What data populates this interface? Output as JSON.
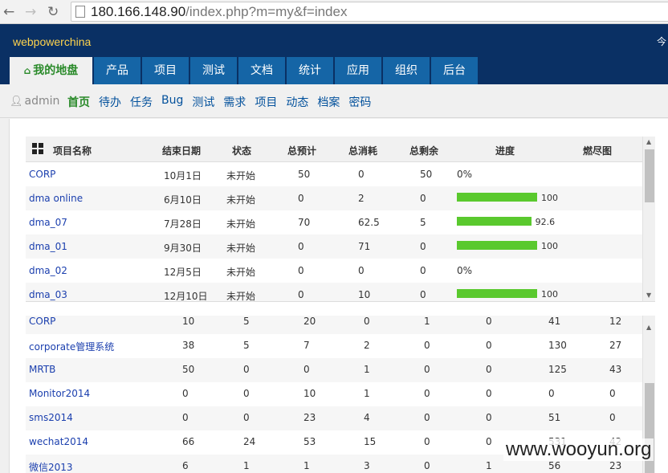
{
  "browser": {
    "url_main": "180.166.148.90",
    "url_path": "/index.php?m=my&f=index"
  },
  "header": {
    "brand": "webpowerchina",
    "right_text": "今"
  },
  "mainnav": [
    {
      "label": "我的地盘",
      "active": true
    },
    {
      "label": "产品"
    },
    {
      "label": "项目"
    },
    {
      "label": "测试"
    },
    {
      "label": "文档"
    },
    {
      "label": "统计"
    },
    {
      "label": "应用"
    },
    {
      "label": "组织"
    },
    {
      "label": "后台"
    }
  ],
  "subnav": {
    "user": "admin",
    "links": [
      {
        "label": "首页",
        "active": true
      },
      {
        "label": "待办"
      },
      {
        "label": "任务"
      },
      {
        "label": "Bug"
      },
      {
        "label": "测试"
      },
      {
        "label": "需求"
      },
      {
        "label": "项目"
      },
      {
        "label": "动态"
      },
      {
        "label": "档案"
      },
      {
        "label": "密码"
      }
    ]
  },
  "project_table": {
    "headers": [
      "项目名称",
      "结束日期",
      "状态",
      "总预计",
      "总消耗",
      "总剩余",
      "进度",
      "燃尽图"
    ],
    "rows": [
      {
        "name": "CORP",
        "end": "10月1日",
        "status": "未开始",
        "est": "50",
        "cons": "0",
        "left": "50",
        "progress": 0,
        "progress_label": "0%"
      },
      {
        "name": "dma online",
        "end": "6月10日",
        "status": "未开始",
        "est": "0",
        "cons": "2",
        "left": "0",
        "progress": 100,
        "progress_label": "100"
      },
      {
        "name": "dma_07",
        "end": "7月28日",
        "status": "未开始",
        "est": "70",
        "cons": "62.5",
        "left": "5",
        "progress": 92.6,
        "progress_label": "92.6"
      },
      {
        "name": "dma_01",
        "end": "9月30日",
        "status": "未开始",
        "est": "0",
        "cons": "71",
        "left": "0",
        "progress": 100,
        "progress_label": "100"
      },
      {
        "name": "dma_02",
        "end": "12月5日",
        "status": "未开始",
        "est": "0",
        "cons": "0",
        "left": "0",
        "progress": 0,
        "progress_label": "0%"
      },
      {
        "name": "dma_03",
        "end": "12月10日",
        "status": "未开始",
        "est": "0",
        "cons": "10",
        "left": "0",
        "progress": 100,
        "progress_label": "100"
      }
    ]
  },
  "product_table": {
    "rows": [
      {
        "name": "CORP",
        "c1": "10",
        "c2": "5",
        "c3": "20",
        "c4": "0",
        "c5": "1",
        "c6": "0",
        "c7": "41",
        "c8": "12"
      },
      {
        "name": "corporate管理系统",
        "c1": "38",
        "c2": "5",
        "c3": "7",
        "c4": "2",
        "c5": "0",
        "c6": "0",
        "c7": "130",
        "c8": "27"
      },
      {
        "name": "MRTB",
        "c1": "50",
        "c2": "0",
        "c3": "0",
        "c4": "1",
        "c5": "0",
        "c6": "0",
        "c7": "125",
        "c8": "43"
      },
      {
        "name": "Monitor2014",
        "c1": "0",
        "c2": "0",
        "c3": "10",
        "c4": "1",
        "c5": "0",
        "c6": "0",
        "c7": "0",
        "c8": "0"
      },
      {
        "name": "sms2014",
        "c1": "0",
        "c2": "0",
        "c3": "23",
        "c4": "4",
        "c5": "0",
        "c6": "0",
        "c7": "51",
        "c8": "0"
      },
      {
        "name": "wechat2014",
        "c1": "66",
        "c2": "24",
        "c3": "53",
        "c4": "15",
        "c5": "0",
        "c6": "0",
        "c7": "531",
        "c8": "42"
      },
      {
        "name": "微信2013",
        "c1": "6",
        "c2": "1",
        "c3": "1",
        "c4": "3",
        "c5": "0",
        "c6": "1",
        "c7": "56",
        "c8": "23"
      }
    ]
  },
  "watermark": "www.wooyun.org"
}
